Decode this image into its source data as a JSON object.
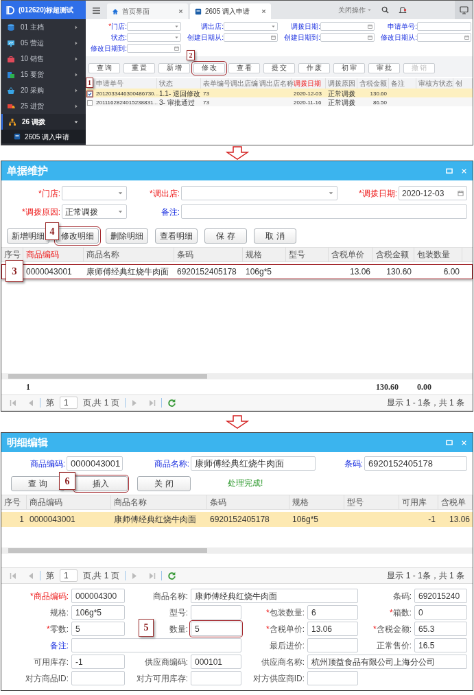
{
  "panel_1": {
    "sidebar": {
      "title": "(012620)标超测试",
      "items": [
        {
          "label": "01 主档",
          "expanded": false
        },
        {
          "label": "05 营运",
          "expanded": false
        },
        {
          "label": "10 销售",
          "expanded": false
        },
        {
          "label": "15 要货",
          "expanded": false
        },
        {
          "label": "20 采购",
          "expanded": false
        },
        {
          "label": "25 进货",
          "expanded": false
        },
        {
          "label": "26 调拨",
          "expanded": true,
          "children": [
            {
              "label": "2605 调入申请",
              "selected": true
            }
          ]
        }
      ]
    },
    "tabs": [
      {
        "label": "首页界面",
        "selected": false
      },
      {
        "label": "2605 调入申请",
        "selected": true
      }
    ],
    "close_menu": "关闭操作",
    "filters": [
      {
        "label": {
          "mark": "*",
          "text": "门店:",
          "kind": "link"
        },
        "input": {
          "kind": "select"
        }
      },
      {
        "label": {
          "text": "调出店:",
          "kind": "link"
        },
        "input": {
          "kind": "select"
        }
      },
      {
        "label": {
          "text": "调拨日期:",
          "kind": "link"
        },
        "input": {
          "kind": "date"
        }
      },
      {
        "label": {
          "text": "申请单号:",
          "kind": "link"
        },
        "input": {
          "kind": "text"
        }
      },
      {
        "label": {
          "text": "状态:",
          "kind": "link"
        },
        "input": {
          "kind": "select"
        }
      },
      {
        "label": {
          "text": "创建日期从:",
          "kind": "link"
        },
        "input": {
          "kind": "date"
        }
      },
      {
        "label": {
          "text": "创建日期到:",
          "kind": "link"
        },
        "input": {
          "kind": "date"
        }
      },
      {
        "label": {
          "text": "修改日期从:",
          "kind": "link"
        },
        "input": {
          "kind": "date"
        }
      },
      {
        "label": {
          "text": "修改日期到:",
          "kind": "link"
        },
        "input": {
          "kind": "date"
        }
      }
    ],
    "toolbar": [
      {
        "label": "查 询",
        "disabled": false
      },
      {
        "label": "重 置",
        "disabled": false
      },
      {
        "label": "新 增",
        "disabled": false
      },
      {
        "label": "修 改",
        "disabled": false,
        "callout": "2"
      },
      {
        "label": "查 看",
        "disabled": false
      },
      {
        "label": "提 交",
        "disabled": false
      },
      {
        "label": "作 废",
        "disabled": false
      },
      {
        "label": "初 审",
        "disabled": false
      },
      {
        "label": "审 批",
        "disabled": false
      },
      {
        "label": "撤 销",
        "disabled": true
      }
    ],
    "table": {
      "columns": [
        {
          "label": "申请单号",
          "highlight": false
        },
        {
          "label": "状态",
          "highlight": false
        },
        {
          "label": "表单编号",
          "highlight": false
        },
        {
          "label": "调出店编",
          "highlight": false
        },
        {
          "label": "调出店名称",
          "highlight": false
        },
        {
          "label": "调拨日期",
          "highlight": true
        },
        {
          "label": "调拨原因",
          "highlight": false
        },
        {
          "label": "含税金额",
          "highlight": false
        },
        {
          "label": "备注",
          "highlight": false
        },
        {
          "label": "审核方状态",
          "highlight": false
        },
        {
          "label": "创",
          "highlight": false
        }
      ],
      "rows": [
        {
          "checked": true,
          "selected": true,
          "callout": "1",
          "cells": [
            "2012033446300486730...",
            "1.1- 退回修改",
            "73",
            null,
            null,
            "2020-12-03",
            "正常调拨",
            "130.60"
          ]
        },
        {
          "checked": false,
          "selected": false,
          "cells": [
            "2011162824015238831...",
            "3- 审批通过",
            "73",
            null,
            null,
            "2020-11-16",
            "正常调拨",
            "86.50"
          ]
        }
      ]
    }
  },
  "panel_2": {
    "title": "单据维护",
    "fields": [
      {
        "label": {
          "mark": "*",
          "text": "门店:",
          "kind": "key"
        },
        "input": {
          "kind": "select"
        }
      },
      {
        "label": {
          "mark": "*",
          "text": "调出店:",
          "kind": "key"
        },
        "input": {
          "kind": "select"
        }
      },
      {
        "label": {
          "mark": "*",
          "text": "调拨日期:",
          "kind": "key"
        },
        "input": {
          "kind": "date",
          "value": "2020-12-03"
        }
      },
      {
        "label": {
          "mark": "*",
          "text": "调拨原因:",
          "kind": "key"
        },
        "input": {
          "kind": "select",
          "value": "正常调拨"
        }
      },
      {
        "label": {
          "text": "备注:",
          "kind": "link"
        },
        "input": {
          "kind": "text"
        }
      }
    ],
    "buttons": [
      {
        "label": "新增明细"
      },
      {
        "label": "修改明细",
        "callout": "4"
      },
      {
        "label": "删除明细"
      },
      {
        "label": "查看明细"
      },
      {
        "label": "保 存"
      },
      {
        "label": "取 消"
      }
    ],
    "table": {
      "columns": [
        {
          "label": "序号",
          "highlight": false
        },
        {
          "label": "商品编码",
          "highlight": true
        },
        {
          "label": "商品名称",
          "highlight": false
        },
        {
          "label": "条码",
          "highlight": false
        },
        {
          "label": "规格",
          "highlight": false
        },
        {
          "label": "型号",
          "highlight": false
        },
        {
          "label": "含税单价",
          "highlight": false
        },
        {
          "label": "含税金额",
          "highlight": false
        },
        {
          "label": "包装数量",
          "highlight": false
        }
      ],
      "rows": [
        {
          "callout": "3",
          "cells": [
            null,
            "0000043001",
            "康师傅经典红烧牛肉面",
            "6920152405178",
            "106g*5",
            null,
            "13.06",
            "130.60",
            "6.00"
          ]
        }
      ],
      "summary": {
        "count": "1",
        "total_amount": "130.60",
        "total_quantity": "0.00"
      }
    },
    "pager": {
      "page_label": "第",
      "page": "1",
      "page_total": "页,共 1 页",
      "summary": "显示 1 - 1条，共 1 条"
    }
  },
  "panel_3": {
    "title": "明细编辑",
    "search_fields": [
      {
        "label": {
          "text": "商品编码:",
          "kind": "link"
        },
        "input": {
          "kind": "text",
          "value": "0000043001"
        }
      },
      {
        "label": {
          "text": "商品名称:",
          "kind": "link"
        },
        "input": {
          "kind": "text",
          "value": "康师傅经典红烧牛肉面"
        }
      },
      {
        "label": {
          "text": "条码:",
          "kind": "link"
        },
        "input": {
          "kind": "text",
          "value": "6920152405178"
        }
      }
    ],
    "buttons": [
      {
        "label": "查 询"
      },
      {
        "label": "插入",
        "callout": "6"
      },
      {
        "label": "关 闭"
      }
    ],
    "message": "处理完成!",
    "table": {
      "columns": [
        {
          "label": "序号",
          "highlight": false
        },
        {
          "label": "商品编码",
          "highlight": false
        },
        {
          "label": "商品名称",
          "highlight": false
        },
        {
          "label": "条码",
          "highlight": false
        },
        {
          "label": "规格",
          "highlight": false
        },
        {
          "label": "型号",
          "highlight": false
        },
        {
          "label": "可用库",
          "highlight": false
        },
        {
          "label": "含税单",
          "highlight": false
        }
      ],
      "rows": [
        {
          "selected": true,
          "cells": [
            "1",
            "0000043001",
            "康师傅经典红烧牛肉面",
            "6920152405178",
            "106g*5",
            null,
            "-1",
            "13.06"
          ]
        }
      ]
    },
    "pager": {
      "page_label": "第",
      "page": "1",
      "page_total": "页,共 1 页",
      "summary": "显示 1 - 1条，共 1 条"
    },
    "form_rows": [
      {
        "fields": [
          {
            "label": {
              "mark": "*",
              "text": "商品编码:",
              "kind": "key"
            },
            "input": {
              "kind": "text",
              "value": "000004300"
            }
          },
          {
            "label": {
              "text": "商品名称:",
              "kind": "plain"
            },
            "input": {
              "kind": "text",
              "value": "康师傅经典红烧牛肉面"
            }
          },
          {
            "label": {
              "text": "条码:",
              "kind": "plain"
            },
            "input": {
              "kind": "text",
              "value": "692015240"
            }
          }
        ]
      },
      {
        "fields": [
          {
            "label": {
              "text": "规格:",
              "kind": "plain"
            },
            "input": {
              "kind": "text",
              "value": "106g*5"
            }
          },
          {
            "label": {
              "text": "型号:",
              "kind": "plain"
            },
            "input": {
              "kind": "text"
            }
          },
          {
            "label": {
              "mark": "*",
              "text": "包装数量:",
              "kind": "plain"
            },
            "input": {
              "kind": "text",
              "value": "6"
            }
          },
          {
            "label": {
              "mark": "*",
              "text": "箱数:",
              "kind": "plain"
            },
            "input": {
              "kind": "text",
              "value": "0"
            }
          }
        ]
      },
      {
        "fields": [
          {
            "label": {
              "mark": "*",
              "text": "零数:",
              "kind": "plain"
            },
            "input": {
              "kind": "text",
              "value": "5"
            }
          },
          {
            "callout": "5",
            "label": {
              "text": "数量:",
              "kind": "plain"
            },
            "input": {
              "kind": "text",
              "value": "5"
            }
          },
          {
            "label": {
              "mark": "*",
              "text": "含税单价:",
              "kind": "plain"
            },
            "input": {
              "kind": "text",
              "value": "13.06"
            }
          },
          {
            "label": {
              "mark": "*",
              "text": "含税金额:",
              "kind": "plain"
            },
            "input": {
              "kind": "text",
              "value": "65.3"
            }
          }
        ]
      },
      {
        "fields": [
          {
            "label": {
              "text": "备注:",
              "kind": "link"
            },
            "input": {
              "kind": "text"
            }
          },
          {
            "label": {
              "text": "最后进价:",
              "kind": "plain"
            },
            "input": {
              "kind": "text"
            }
          },
          {
            "label": {
              "text": "正常售价:",
              "kind": "plain"
            },
            "input": {
              "kind": "text",
              "value": "16.5"
            }
          }
        ]
      },
      {
        "fields": [
          {
            "label": {
              "text": "可用库存:",
              "kind": "plain"
            },
            "input": {
              "kind": "text",
              "value": "-1"
            }
          },
          {
            "label": {
              "text": "供应商编码:",
              "kind": "plain"
            },
            "input": {
              "kind": "text",
              "value": "000101"
            }
          },
          {
            "label": {
              "text": "供应商名称:",
              "kind": "plain"
            },
            "input": {
              "kind": "text",
              "value": "杭州顶益食品有限公司上海分公司"
            }
          }
        ]
      },
      {
        "fields": [
          {
            "label": {
              "text": "对方商品ID:",
              "kind": "plain"
            },
            "input": {
              "kind": "text"
            }
          },
          {
            "label": {
              "text": "对方可用库存:",
              "kind": "plain"
            },
            "input": {
              "kind": "text"
            }
          },
          {
            "label": {
              "text": "对方供应商ID:",
              "kind": "plain"
            },
            "input": {
              "kind": "text"
            }
          }
        ]
      }
    ]
  }
}
